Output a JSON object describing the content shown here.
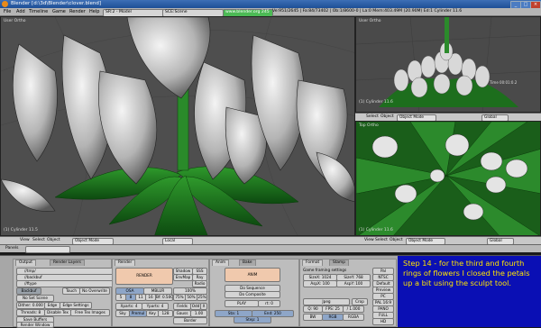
{
  "window": {
    "title": "Blender [d:\\3d\\Blender\\clover.blend]"
  },
  "menubar": {
    "items": [
      "File",
      "Add",
      "Timeline",
      "Game",
      "Render",
      "Help"
    ],
    "screen": "SR:2 - Model",
    "scene": "SCE:Scene",
    "url": "www.blender.org 245",
    "stats": "Ve:951/2645 | Fa:84/73402 | Ob:1/8600-0 | La:0  Mem:403.49M (20.90M)  Ed:1 Cylinder 11.6"
  },
  "viewports": {
    "main": {
      "label": "User Ortho",
      "corner_label": "(1) Cylinder 11.5"
    },
    "top_right": {
      "label": "User Ortho",
      "corner_label": "(1) Cylinder 11.6",
      "sub_label": "Time 00:01:0.2"
    },
    "bottom_right": {
      "label": "Top Ortho",
      "corner_label": "(1) Cylinder 11.6"
    }
  },
  "viewport_header": {
    "view": "View",
    "select": "Select",
    "object": "Object",
    "mode": "Object Mode",
    "layer": "Local"
  },
  "small_header": {
    "view": "View",
    "select": "Select",
    "object": "Object",
    "mode": "Object Mode",
    "layer": "Global"
  },
  "buttons": {
    "panels": "Panels",
    "output": {
      "tab1": "Output",
      "tab2": "Render Layers",
      "path1": "//tmp/",
      "path2": "//backbuf",
      "ftype": "//ftype",
      "backbuf": "Backbuf",
      "edge": "Edge",
      "edge_settings": "Edge Settings",
      "threads": "Threads: 8",
      "touch": "Touch",
      "no_overwrite": "No Overwrite",
      "disable_tex": "Disable Tex",
      "free_tex_images": "Free Tex Images",
      "save_buffers": "Save Buffers",
      "render_window": "Render Window",
      "dither": "Dither: 0.000",
      "no_sel_scene": "No Set Scene"
    },
    "render": {
      "tab": "Render",
      "render_btn": "RENDER",
      "shadow": "Shadow",
      "ssr": "SSS",
      "envmap": "EnvMap",
      "ray": "Ray",
      "radio": "Radio",
      "osa": "OSA",
      "mblur": "MBLUR",
      "osa_vals": [
        "5",
        "8",
        "11",
        "16"
      ],
      "bf": "Bf: 0.500",
      "xparts": "Xparts: 4",
      "yparts": "Yparts: 4",
      "fields": "Fields",
      "odd": "Odd",
      "x": "X",
      "sky": "Sky",
      "premul": "Premul",
      "key": "Key",
      "border": "Border",
      "gauss": "Gauss",
      "gauss_val": "1.00",
      "size": "128",
      "pct100": "100%",
      "pct75": "75%",
      "pct50": "50%",
      "pct25": "25%"
    },
    "anim": {
      "tab1": "Anim",
      "tab2": "Bake",
      "anim_btn": "ANIM",
      "do_sequence": "Do Sequence",
      "do_composite": "Do Composite",
      "play": "PLAY",
      "rt": "rt: 0",
      "sta": "Sta: 1",
      "end": "End: 250",
      "step": "Step: 1"
    },
    "format": {
      "tab1": "Format",
      "tab2": "Stamp",
      "game_framing": "Game framing settings",
      "sizex": "SizeX: 1024",
      "sizey": "SizeY: 768",
      "aspx": "AspX: 100",
      "aspy": "AspY: 100",
      "jpeg": "Jpeg",
      "crop": "Crop",
      "q": "Q: 90",
      "fps": "FPS: 25",
      "fps2": "/ 1.000",
      "bw": "BW",
      "rgb": "RGB",
      "rgba": "RGBA",
      "presets": [
        "Pal",
        "NTSC",
        "Default",
        "Preview",
        "PC",
        "PAL 16:9",
        "PANO",
        "FULL",
        "HD"
      ]
    }
  },
  "note": {
    "text": "Step 14 - for the third and fourth rings of flowers I closed the petals up a bit using the sculpt tool."
  }
}
